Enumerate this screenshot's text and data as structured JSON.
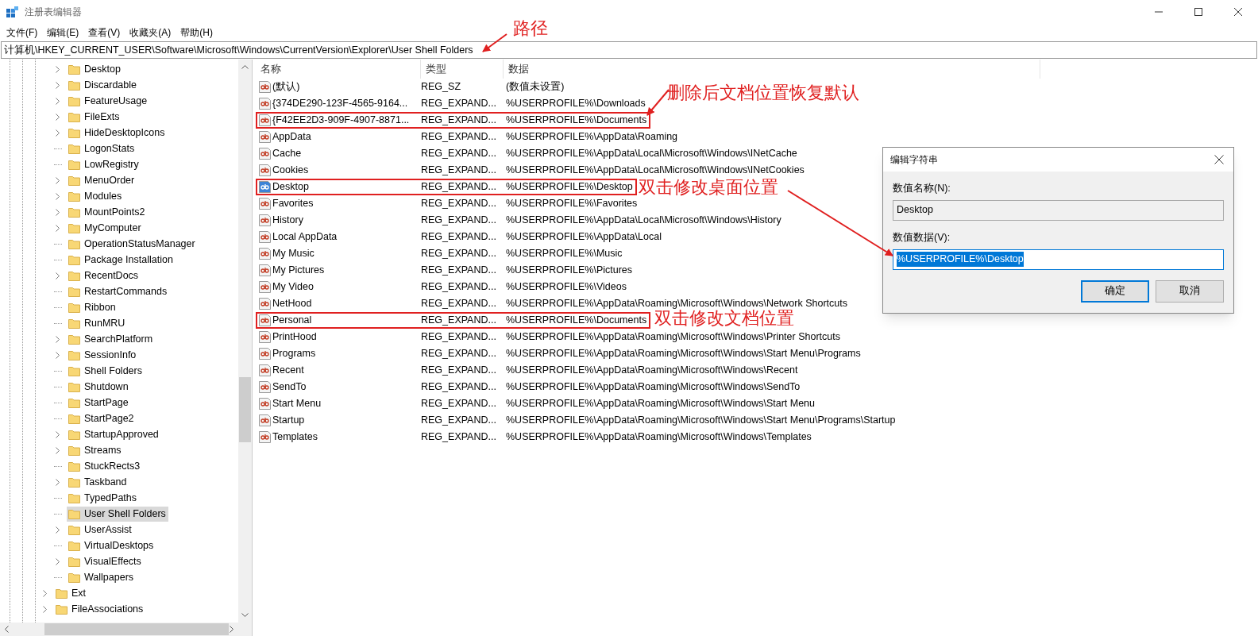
{
  "window": {
    "title": "注册表编辑器"
  },
  "menu": [
    "文件(F)",
    "编辑(E)",
    "查看(V)",
    "收藏夹(A)",
    "帮助(H)"
  ],
  "address": "计算机\\HKEY_CURRENT_USER\\Software\\Microsoft\\Windows\\CurrentVersion\\Explorer\\User Shell Folders",
  "tree": {
    "items": [
      {
        "children": [
          {
            "label": "Desktop",
            "expandable": true,
            "selected": false
          },
          {
            "label": "Discardable",
            "expandable": true,
            "selected": false
          },
          {
            "label": "FeatureUsage",
            "expandable": true,
            "selected": false
          },
          {
            "label": "FileExts",
            "expandable": true,
            "selected": false
          },
          {
            "label": "HideDesktopIcons",
            "expandable": true,
            "selected": false
          },
          {
            "label": "LogonStats",
            "expandable": false,
            "selected": false
          },
          {
            "label": "LowRegistry",
            "expandable": false,
            "selected": false
          },
          {
            "label": "MenuOrder",
            "expandable": true,
            "selected": false
          },
          {
            "label": "Modules",
            "expandable": true,
            "selected": false
          },
          {
            "label": "MountPoints2",
            "expandable": true,
            "selected": false
          },
          {
            "label": "MyComputer",
            "expandable": true,
            "selected": false
          },
          {
            "label": "OperationStatusManager",
            "expandable": false,
            "selected": false
          },
          {
            "label": "Package Installation",
            "expandable": false,
            "selected": false
          },
          {
            "label": "RecentDocs",
            "expandable": true,
            "selected": false
          },
          {
            "label": "RestartCommands",
            "expandable": false,
            "selected": false
          },
          {
            "label": "Ribbon",
            "expandable": false,
            "selected": false
          },
          {
            "label": "RunMRU",
            "expandable": false,
            "selected": false
          },
          {
            "label": "SearchPlatform",
            "expandable": true,
            "selected": false
          },
          {
            "label": "SessionInfo",
            "expandable": true,
            "selected": false
          },
          {
            "label": "Shell Folders",
            "expandable": false,
            "selected": false
          },
          {
            "label": "Shutdown",
            "expandable": false,
            "selected": false
          },
          {
            "label": "StartPage",
            "expandable": false,
            "selected": false
          },
          {
            "label": "StartPage2",
            "expandable": false,
            "selected": false
          },
          {
            "label": "StartupApproved",
            "expandable": true,
            "selected": false
          },
          {
            "label": "Streams",
            "expandable": true,
            "selected": false
          },
          {
            "label": "StuckRects3",
            "expandable": false,
            "selected": false
          },
          {
            "label": "Taskband",
            "expandable": true,
            "selected": false
          },
          {
            "label": "TypedPaths",
            "expandable": false,
            "selected": false
          },
          {
            "label": "User Shell Folders",
            "expandable": false,
            "selected": true
          },
          {
            "label": "UserAssist",
            "expandable": true,
            "selected": false
          },
          {
            "label": "VirtualDesktops",
            "expandable": false,
            "selected": false
          },
          {
            "label": "VisualEffects",
            "expandable": true,
            "selected": false
          },
          {
            "label": "Wallpapers",
            "expandable": false,
            "selected": false
          }
        ]
      },
      {
        "label": "Ext",
        "expandable": true,
        "selected": false
      },
      {
        "label": "FileAssociations",
        "expandable": true,
        "selected": false
      }
    ]
  },
  "values": {
    "columns": [
      "名称",
      "类型",
      "数据"
    ],
    "rows": [
      {
        "name": "(默认)",
        "type": "REG_SZ",
        "data": "(数值未设置)",
        "selected": false,
        "highlighted": false
      },
      {
        "name": "{374DE290-123F-4565-9164...",
        "type": "REG_EXPAND...",
        "data": "%USERPROFILE%\\Downloads",
        "selected": false,
        "highlighted": false
      },
      {
        "name": "{F42EE2D3-909F-4907-8871...",
        "type": "REG_EXPAND...",
        "data": "%USERPROFILE%\\Documents",
        "selected": false,
        "highlighted": true
      },
      {
        "name": "AppData",
        "type": "REG_EXPAND...",
        "data": "%USERPROFILE%\\AppData\\Roaming",
        "selected": false,
        "highlighted": false
      },
      {
        "name": "Cache",
        "type": "REG_EXPAND...",
        "data": "%USERPROFILE%\\AppData\\Local\\Microsoft\\Windows\\INetCache",
        "selected": false,
        "highlighted": false
      },
      {
        "name": "Cookies",
        "type": "REG_EXPAND...",
        "data": "%USERPROFILE%\\AppData\\Local\\Microsoft\\Windows\\INetCookies",
        "selected": false,
        "highlighted": false
      },
      {
        "name": "Desktop",
        "type": "REG_EXPAND...",
        "data": "%USERPROFILE%\\Desktop",
        "selected": true,
        "highlighted": true
      },
      {
        "name": "Favorites",
        "type": "REG_EXPAND...",
        "data": "%USERPROFILE%\\Favorites",
        "selected": false,
        "highlighted": false
      },
      {
        "name": "History",
        "type": "REG_EXPAND...",
        "data": "%USERPROFILE%\\AppData\\Local\\Microsoft\\Windows\\History",
        "selected": false,
        "highlighted": false
      },
      {
        "name": "Local AppData",
        "type": "REG_EXPAND...",
        "data": "%USERPROFILE%\\AppData\\Local",
        "selected": false,
        "highlighted": false
      },
      {
        "name": "My Music",
        "type": "REG_EXPAND...",
        "data": "%USERPROFILE%\\Music",
        "selected": false,
        "highlighted": false
      },
      {
        "name": "My Pictures",
        "type": "REG_EXPAND...",
        "data": "%USERPROFILE%\\Pictures",
        "selected": false,
        "highlighted": false
      },
      {
        "name": "My Video",
        "type": "REG_EXPAND...",
        "data": "%USERPROFILE%\\Videos",
        "selected": false,
        "highlighted": false
      },
      {
        "name": "NetHood",
        "type": "REG_EXPAND...",
        "data": "%USERPROFILE%\\AppData\\Roaming\\Microsoft\\Windows\\Network Shortcuts",
        "selected": false,
        "highlighted": false
      },
      {
        "name": "Personal",
        "type": "REG_EXPAND...",
        "data": "%USERPROFILE%\\Documents",
        "selected": false,
        "highlighted": true
      },
      {
        "name": "PrintHood",
        "type": "REG_EXPAND...",
        "data": "%USERPROFILE%\\AppData\\Roaming\\Microsoft\\Windows\\Printer Shortcuts",
        "selected": false,
        "highlighted": false
      },
      {
        "name": "Programs",
        "type": "REG_EXPAND...",
        "data": "%USERPROFILE%\\AppData\\Roaming\\Microsoft\\Windows\\Start Menu\\Programs",
        "selected": false,
        "highlighted": false
      },
      {
        "name": "Recent",
        "type": "REG_EXPAND...",
        "data": "%USERPROFILE%\\AppData\\Roaming\\Microsoft\\Windows\\Recent",
        "selected": false,
        "highlighted": false
      },
      {
        "name": "SendTo",
        "type": "REG_EXPAND...",
        "data": "%USERPROFILE%\\AppData\\Roaming\\Microsoft\\Windows\\SendTo",
        "selected": false,
        "highlighted": false
      },
      {
        "name": "Start Menu",
        "type": "REG_EXPAND...",
        "data": "%USERPROFILE%\\AppData\\Roaming\\Microsoft\\Windows\\Start Menu",
        "selected": false,
        "highlighted": false
      },
      {
        "name": "Startup",
        "type": "REG_EXPAND...",
        "data": "%USERPROFILE%\\AppData\\Roaming\\Microsoft\\Windows\\Start Menu\\Programs\\Startup",
        "selected": false,
        "highlighted": false
      },
      {
        "name": "Templates",
        "type": "REG_EXPAND...",
        "data": "%USERPROFILE%\\AppData\\Roaming\\Microsoft\\Windows\\Templates",
        "selected": false,
        "highlighted": false
      }
    ]
  },
  "dialog": {
    "title": "编辑字符串",
    "name_label": "数值名称(N):",
    "name_value": "Desktop",
    "data_label": "数值数据(V):",
    "data_value": "%USERPROFILE%\\Desktop",
    "buttons": [
      {
        "label": "确定",
        "default": true
      },
      {
        "label": "取消",
        "default": false
      }
    ]
  },
  "annotations": [
    {
      "text": "路径"
    },
    {
      "text": "删除后文档位置恢复默认"
    },
    {
      "text": "双击修改桌面位置"
    },
    {
      "text": "双击修改文档位置"
    }
  ]
}
